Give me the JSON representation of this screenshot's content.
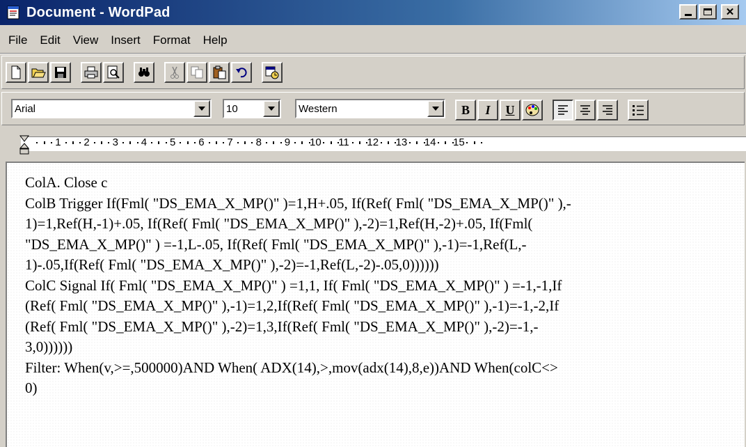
{
  "window": {
    "title": "Document - WordPad",
    "controls": {
      "minimize": "_",
      "maximize": "□",
      "close": "✕"
    }
  },
  "menu": {
    "items": [
      "File",
      "Edit",
      "View",
      "Insert",
      "Format",
      "Help"
    ]
  },
  "toolbar": {
    "buttons": [
      "new-icon",
      "open-icon",
      "save-icon",
      "print-icon",
      "print-preview-icon",
      "find-icon",
      "cut-icon",
      "copy-icon",
      "paste-icon",
      "undo-icon",
      "date-time-icon"
    ]
  },
  "format_bar": {
    "font": "Arial",
    "size": "10",
    "script": "Western",
    "bold_label": "B",
    "italic_label": "I",
    "underline_label": "U"
  },
  "ruler": {
    "labels": [
      "1",
      "2",
      "3",
      "4",
      "5",
      "6",
      "7",
      "8",
      "9",
      "10",
      "11",
      "12",
      "13",
      "14",
      "15"
    ]
  },
  "document": {
    "lines": [
      "ColA. Close c",
      "ColB Trigger If(Fml( \"DS_EMA_X_MP()\" )=1,H+.05, If(Ref( Fml( \"DS_EMA_X_MP()\" ),-",
      "1)=1,Ref(H,-1)+.05, If(Ref( Fml( \"DS_EMA_X_MP()\" ),-2)=1,Ref(H,-2)+.05, If(Fml(",
      "\"DS_EMA_X_MP()\" ) =-1,L-.05, If(Ref( Fml( \"DS_EMA_X_MP()\" ),-1)=-1,Ref(L,-",
      "1)-.05,If(Ref( Fml( \"DS_EMA_X_MP()\" ),-2)=-1,Ref(L,-2)-.05,0))))))",
      "ColC Signal If( Fml( \"DS_EMA_X_MP()\" ) =1,1, If( Fml( \"DS_EMA_X_MP()\" ) =-1,-1,If",
      "(Ref( Fml( \"DS_EMA_X_MP()\" ),-1)=1,2,If(Ref( Fml( \"DS_EMA_X_MP()\" ),-1)=-1,-2,If",
      "(Ref( Fml( \"DS_EMA_X_MP()\" ),-2)=1,3,If(Ref( Fml( \"DS_EMA_X_MP()\" ),-2)=-1,-",
      "3,0))))))",
      "Filter: When(v,>=,500000)AND When( ADX(14),>,mov(adx(14),8,e))AND When(colC<>",
      "0)"
    ]
  }
}
